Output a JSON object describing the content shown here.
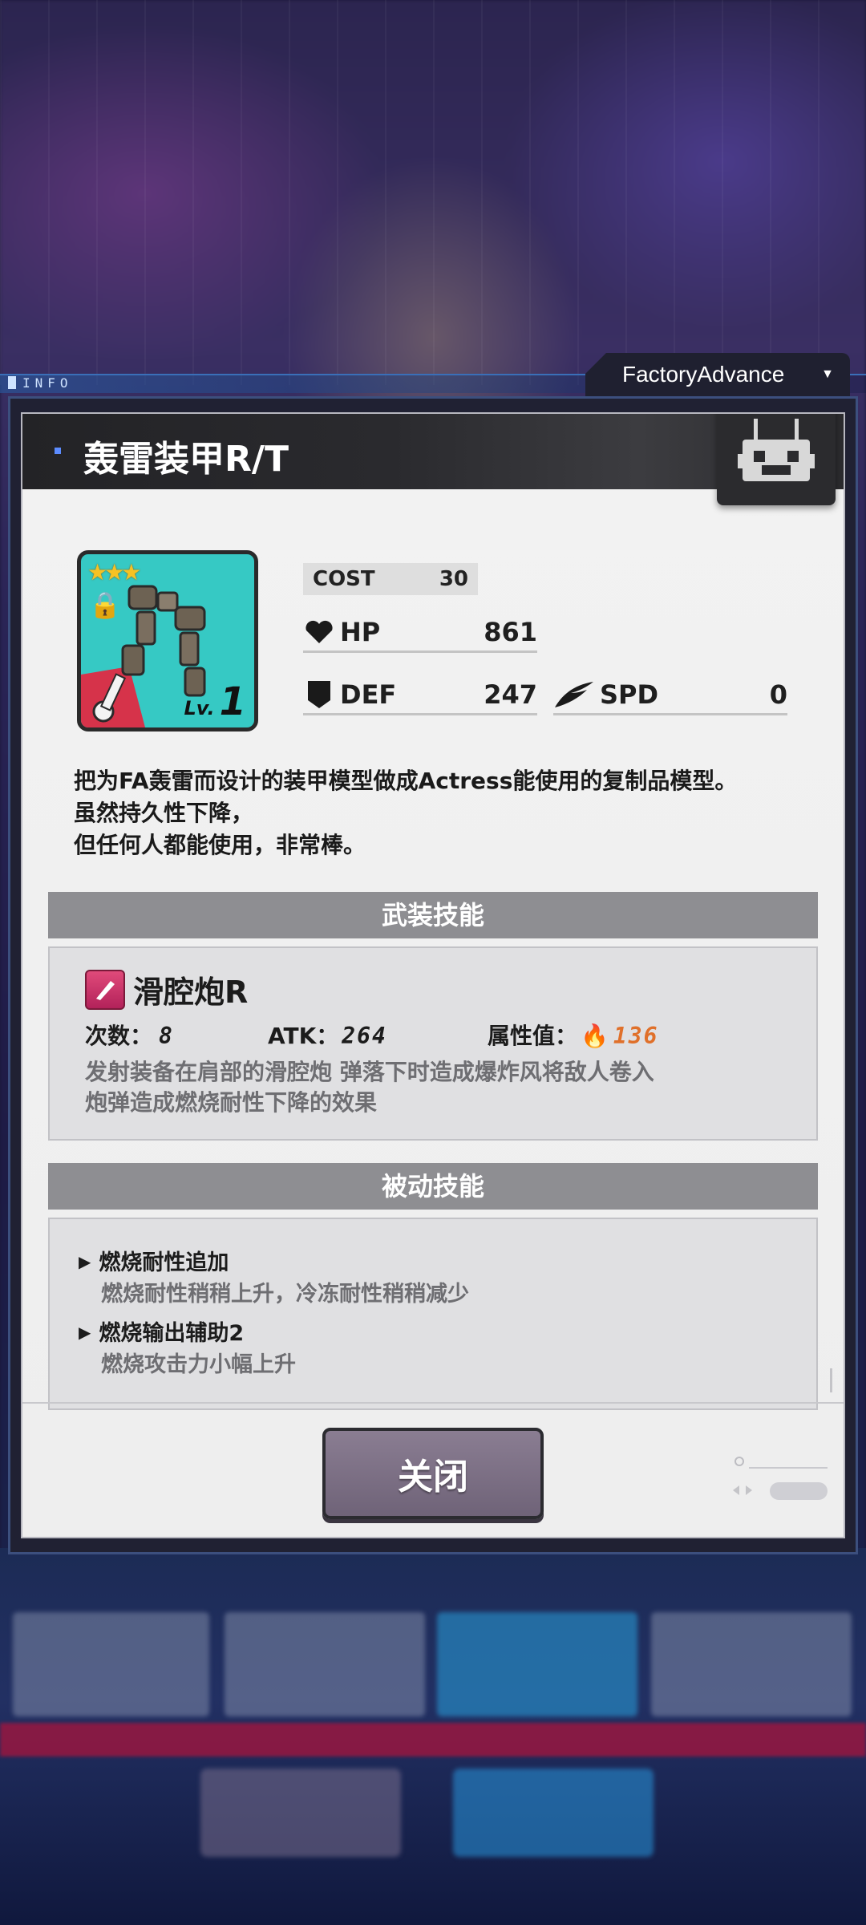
{
  "window": {
    "info_label": "INFO",
    "tab_label": "FactoryAdvance",
    "title": "轰雷装甲R/T"
  },
  "item": {
    "stars": 3,
    "level_prefix": "Lv.",
    "level": "1",
    "cost_label": "COST",
    "cost_value": "30",
    "hp_label": "HP",
    "hp_value": "861",
    "def_label": "DEF",
    "def_value": "247",
    "spd_label": "SPD",
    "spd_value": "0",
    "icons": {
      "hp": "heart-icon",
      "def": "shield-icon",
      "spd": "wing-icon",
      "lock": "lock-icon"
    },
    "description": [
      "把为FA轰雷而设计的装甲模型做成Actress能使用的复制品模型。",
      "虽然持久性下降，",
      "但任何人都能使用，非常棒。"
    ]
  },
  "weapon_skill": {
    "section_title": "武装技能",
    "name": "滑腔炮R",
    "uses_label": "次数：",
    "uses_value": "8",
    "atk_label": "ATK：",
    "atk_value": "264",
    "attr_label": "属性值：",
    "attr_value": "136",
    "attr_icon": "fire-icon",
    "description": [
      "发射装备在肩部的滑腔炮 弹落下时造成爆炸风将敌人卷入",
      "炮弹造成燃烧耐性下降的效果"
    ]
  },
  "passive_skills": {
    "section_title": "被动技能",
    "items": [
      {
        "name": "燃烧耐性追加",
        "desc": "燃烧耐性稍稍上升，冷冻耐性稍稍减少"
      },
      {
        "name": "燃烧输出辅助2",
        "desc": "燃烧攻击力小幅上升"
      }
    ]
  },
  "footer": {
    "close_label": "关闭"
  },
  "colors": {
    "accent_teal": "#36c9c4",
    "fire_orange": "#e0702a",
    "header_dark": "#232326",
    "button": "#7d7186"
  }
}
